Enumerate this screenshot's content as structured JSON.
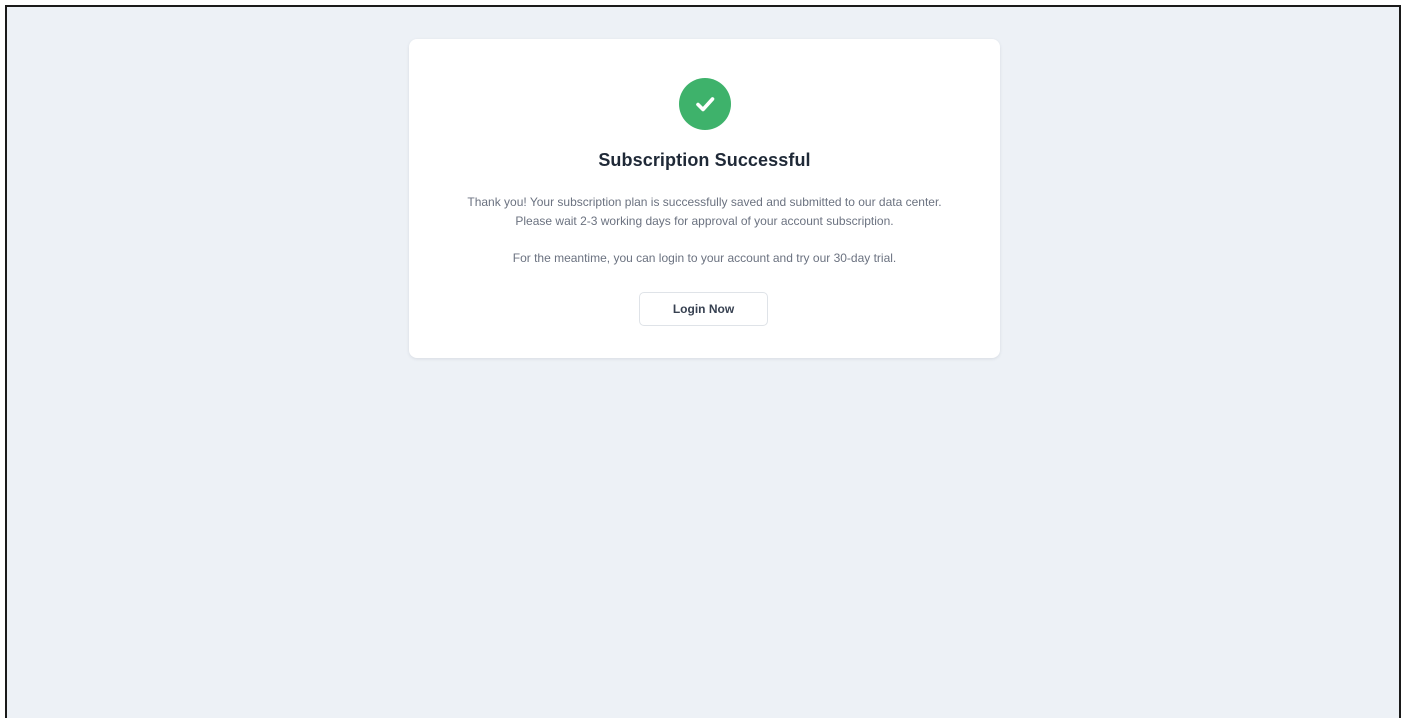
{
  "status": {
    "icon": "check-circle-icon",
    "color": "#3eb26b"
  },
  "title": "Subscription Successful",
  "message": {
    "line1": "Thank you! Your subscription plan is successfully saved and submitted to our data center.",
    "line2": "Please wait 2-3 working days for approval of your account subscription.",
    "line3": "For the meantime, you can login to your account and try our 30-day trial."
  },
  "actions": {
    "login_label": "Login Now"
  },
  "colors": {
    "page_background": "#edf1f6",
    "card_background": "#ffffff",
    "title_text": "#1f2937",
    "body_text": "#6b7280"
  }
}
